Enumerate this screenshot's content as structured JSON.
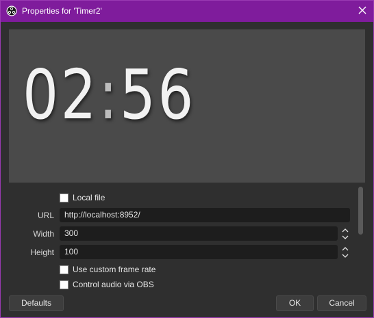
{
  "window": {
    "title": "Properties for 'Timer2'",
    "accent_color": "#7f1c9c",
    "app_icon": "obs-logo-icon",
    "close_icon": "close-icon"
  },
  "preview": {
    "timer_minutes": "02",
    "timer_separator": ":",
    "timer_seconds": "56"
  },
  "properties": {
    "local_file": {
      "label": "Local file",
      "checked": false
    },
    "url": {
      "label": "URL",
      "value": "http://localhost:8952/"
    },
    "width": {
      "label": "Width",
      "value": "300"
    },
    "height": {
      "label": "Height",
      "value": "100"
    },
    "custom_frame_rate": {
      "label": "Use custom frame rate",
      "checked": false
    },
    "control_audio": {
      "label": "Control audio via OBS",
      "checked": false
    }
  },
  "buttons": {
    "defaults": "Defaults",
    "ok": "OK",
    "cancel": "Cancel"
  }
}
